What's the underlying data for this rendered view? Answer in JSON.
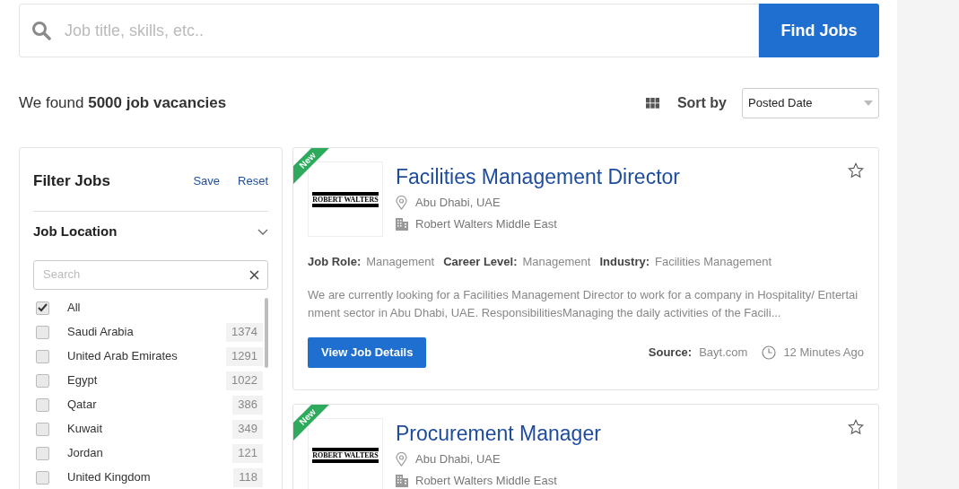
{
  "search": {
    "placeholder": "Job title, skills, etc..",
    "button": "Find Jobs"
  },
  "results": {
    "summary": "We found **5000 job vacancies**",
    "sort_label": "Sort by",
    "sort_value": "Posted Date"
  },
  "filter": {
    "title": "Filter Jobs",
    "actions": [
      "Save",
      "Reset"
    ],
    "section": {
      "title": "Job Location",
      "expanded": true,
      "search_placeholder": "Search",
      "options": [
        {
          "label": "All",
          "checked": true
        },
        {
          "label": "Saudi Arabia",
          "count": "1374",
          "checked": false
        },
        {
          "label": "United Arab Emirates",
          "count": "1291",
          "checked": false
        },
        {
          "label": "Egypt",
          "count": "1022",
          "checked": false
        },
        {
          "label": "Qatar",
          "count": "386",
          "checked": false
        },
        {
          "label": "Kuwait",
          "count": "349",
          "checked": false
        },
        {
          "label": "Jordan",
          "count": "121",
          "checked": false
        },
        {
          "label": "United Kingdom",
          "count": "118",
          "checked": false
        }
      ]
    }
  },
  "jobs": [
    {
      "badge": "New",
      "logo_text": "ROBERT WALTERS",
      "title": "Facilities Management Director",
      "location": "Abu Dhabi, UAE",
      "company": "Robert Walters Middle East",
      "starred": false,
      "details": [
        {
          "label": "Job Role:",
          "value": "Management"
        },
        {
          "label": "Career Level:",
          "value": "Management"
        },
        {
          "label": "Industry:",
          "value": "Facilities Management"
        }
      ],
      "description": "We are currently looking for a Facilities Management Director to work for a company in Hospitality/ Entertainment sector in Abu Dhabi, UAE. ResponsibilitiesManaging the daily activities of the Facili...",
      "button": "View Job Details",
      "source_label": "Source:",
      "source": "Bayt.com",
      "posted": "12 Minutes Ago"
    },
    {
      "badge": "New",
      "logo_text": "ROBERT WALTERS",
      "title": "Procurement Manager",
      "location": "Abu Dhabi, UAE",
      "company": "Robert Walters Middle East",
      "starred": false
    }
  ]
}
